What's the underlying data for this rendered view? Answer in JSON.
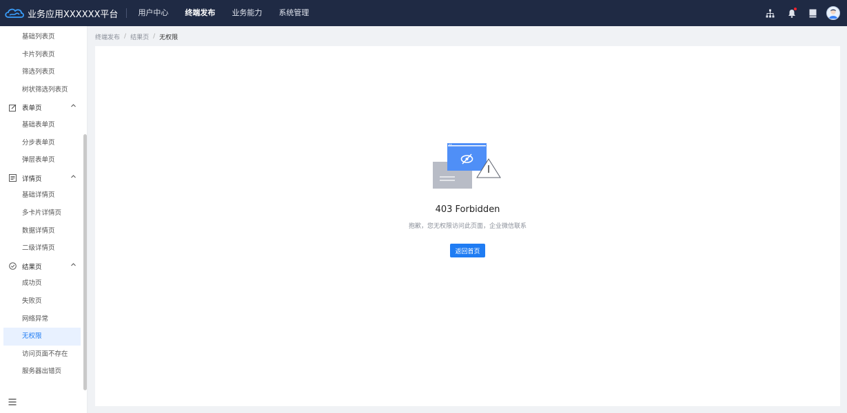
{
  "header": {
    "app_title": "业务应用XXXXXX平台",
    "nav": [
      {
        "label": "用户中心",
        "active": false
      },
      {
        "label": "终端发布",
        "active": true
      },
      {
        "label": "业务能力",
        "active": false
      },
      {
        "label": "系统管理",
        "active": false
      }
    ],
    "icons": [
      "org-tree-icon",
      "bell-icon",
      "book-icon",
      "avatar"
    ]
  },
  "sidebar": {
    "items": [
      {
        "type": "sub",
        "label": "基础列表页"
      },
      {
        "type": "sub",
        "label": "卡片列表页"
      },
      {
        "type": "sub",
        "label": "筛选列表页"
      },
      {
        "type": "sub",
        "label": "树状筛选列表页"
      },
      {
        "type": "group",
        "label": "表单页",
        "icon": "edit-icon"
      },
      {
        "type": "sub",
        "label": "基础表单页"
      },
      {
        "type": "sub",
        "label": "分步表单页"
      },
      {
        "type": "sub",
        "label": "弹层表单页"
      },
      {
        "type": "group",
        "label": "详情页",
        "icon": "document-icon"
      },
      {
        "type": "sub",
        "label": "基础详情页"
      },
      {
        "type": "sub",
        "label": "多卡片详情页"
      },
      {
        "type": "sub",
        "label": "数据详情页"
      },
      {
        "type": "sub",
        "label": "二级详情页"
      },
      {
        "type": "group",
        "label": "结果页",
        "icon": "check-circle-icon"
      },
      {
        "type": "sub",
        "label": "成功页"
      },
      {
        "type": "sub",
        "label": "失败页"
      },
      {
        "type": "sub",
        "label": "网络异常"
      },
      {
        "type": "sub",
        "label": "无权限",
        "active": true
      },
      {
        "type": "sub",
        "label": "访问页面不存在"
      },
      {
        "type": "sub",
        "label": "服务器出错页"
      }
    ]
  },
  "breadcrumb": {
    "items": [
      "终端发布",
      "结果页"
    ],
    "current": "无权限",
    "separator": "/"
  },
  "result": {
    "title": "403 Forbidden",
    "subtitle": "抱歉，您无权限访问此页面，企业微信联系",
    "button_label": "返回首页",
    "illustration": "no-permission-illustration"
  },
  "colors": {
    "header_bg": "#1f2a44",
    "primary": "#1f7cf3",
    "active_menu_bg": "#e8f1ff",
    "page_bg": "#f0f2f5"
  }
}
